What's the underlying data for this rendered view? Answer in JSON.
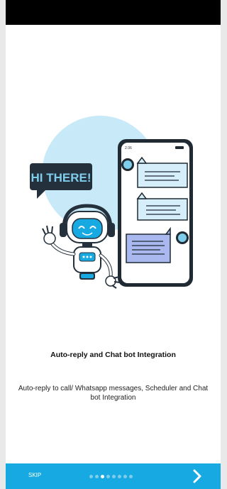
{
  "status_bar": {
    "color": "#000000"
  },
  "illustration": {
    "speech_bubble_text": "HI THERE!",
    "phone_time": "2:36",
    "accent_color": "#17a9e1"
  },
  "onboarding": {
    "title": "Auto-reply and Chat bot Integration",
    "description": "Auto-reply to call/ Whatsapp messages, Scheduler and Chat bot Integration"
  },
  "bottom_bar": {
    "background": "#17a9e1",
    "skip_label": "SKIP",
    "page_count": 8,
    "active_page": 3,
    "next_icon": "chevron-right-icon"
  }
}
